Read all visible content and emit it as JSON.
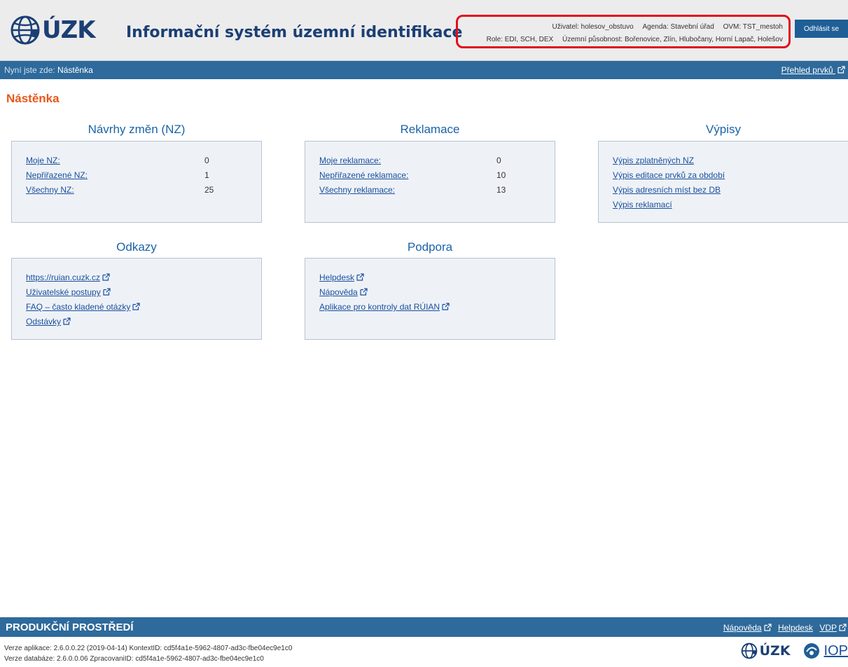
{
  "header": {
    "logo_text": "ÚZK",
    "app_title": "Informační systém územní identifikace",
    "user": "Uživatel: holesov_obstuvo",
    "agenda": "Agenda: Stavební úřad",
    "ovm": "OVM: TST_mestoh",
    "role": "Role: EDI, SCH, DEX",
    "scope": "Územní působnost: Bořenovice, Zlín, Hlubočany, Horní Lapač, Holešov",
    "logout_label": "Odhlásit se"
  },
  "nav": {
    "prefix": "Nyní jste zde:",
    "current": "Nástěnka",
    "right_link": "Přehled prvků"
  },
  "page_title": "Nástěnka",
  "sections": {
    "nz": {
      "title": "Návrhy změn (NZ)",
      "rows": [
        {
          "label": "Moje NZ:",
          "value": "0"
        },
        {
          "label": "Nepřiřazené NZ:",
          "value": "1"
        },
        {
          "label": "Všechny NZ:",
          "value": "25"
        }
      ]
    },
    "reklamace": {
      "title": "Reklamace",
      "rows": [
        {
          "label": "Moje reklamace:",
          "value": "0"
        },
        {
          "label": "Nepřiřazené reklamace:",
          "value": "10"
        },
        {
          "label": "Všechny reklamace:",
          "value": "13"
        }
      ]
    },
    "vypisy": {
      "title": "Výpisy",
      "links": [
        "Výpis zplatněných NZ",
        "Výpis editace prvků za období",
        "Výpis adresních míst bez DB",
        "Výpis reklamací"
      ]
    },
    "odkazy": {
      "title": "Odkazy",
      "links": [
        "https://ruian.cuzk.cz",
        "Uživatelské postupy",
        "FAQ – často kladené otázky",
        "Odstávky"
      ]
    },
    "podpora": {
      "title": "Podpora",
      "links": [
        "Helpdesk",
        "Nápověda",
        "Aplikace pro kontroly dat RÚIAN"
      ]
    }
  },
  "footer": {
    "environment": "PRODUKČNÍ PROSTŘEDÍ",
    "links": [
      "Nápověda",
      "Helpdesk",
      "VDP"
    ],
    "version_app": "Verze aplikace: 2.6.0.0.22 (2019-04-14) KontextID: cd5f4a1e-5962-4807-ad3c-fbe04ec9e1c0",
    "version_db": "Verze databáze: 2.6.0.0.06 ZpracovaniID: cd5f4a1e-5962-4807-ad3c-fbe04ec9e1c0",
    "logo_text": "ÚZK",
    "iop_text": "IOP"
  },
  "icons": {
    "external_link": "external-link-icon",
    "globe_logo": "globe-logo-icon",
    "iss_logo": "iss-logo-icon"
  },
  "colors": {
    "header_bg": "#ececec",
    "nav_bg": "#2e6a9b",
    "title_orange": "#e8571a",
    "link_blue": "#1a4f9c",
    "section_blue": "#1a63a8",
    "highlight_red": "#e0101e"
  }
}
